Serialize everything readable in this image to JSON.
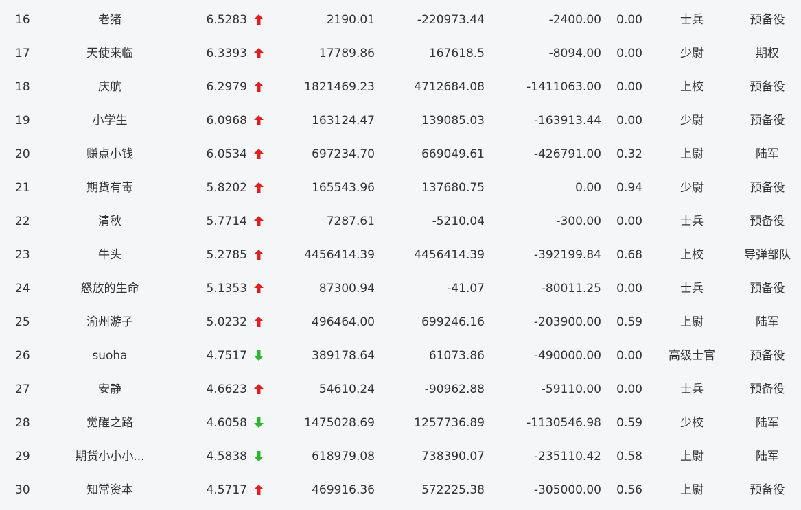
{
  "colors": {
    "up": "#e02020",
    "down": "#2bb52b",
    "text": "#333333",
    "background": "#f5f6f8"
  },
  "rows": [
    {
      "rank": "16",
      "name": "老猪",
      "score": "6.5283",
      "trend": "up",
      "v1": "2190.01",
      "v2": "-220973.44",
      "v3": "-2400.00",
      "ratio": "0.00",
      "level": "士兵",
      "category": "预备役"
    },
    {
      "rank": "17",
      "name": "天使来临",
      "score": "6.3393",
      "trend": "up",
      "v1": "17789.86",
      "v2": "167618.5",
      "v3": "-8094.00",
      "ratio": "0.00",
      "level": "少尉",
      "category": "期权"
    },
    {
      "rank": "18",
      "name": "庆航",
      "score": "6.2979",
      "trend": "up",
      "v1": "1821469.23",
      "v2": "4712684.08",
      "v3": "-1411063.00",
      "ratio": "0.00",
      "level": "上校",
      "category": "预备役"
    },
    {
      "rank": "19",
      "name": "小学生",
      "score": "6.0968",
      "trend": "up",
      "v1": "163124.47",
      "v2": "139085.03",
      "v3": "-163913.44",
      "ratio": "0.00",
      "level": "少尉",
      "category": "预备役"
    },
    {
      "rank": "20",
      "name": "赚点小钱",
      "score": "6.0534",
      "trend": "up",
      "v1": "697234.70",
      "v2": "669049.61",
      "v3": "-426791.00",
      "ratio": "0.32",
      "level": "上尉",
      "category": "陆军"
    },
    {
      "rank": "21",
      "name": "期货有毒",
      "score": "5.8202",
      "trend": "up",
      "v1": "165543.96",
      "v2": "137680.75",
      "v3": "0.00",
      "ratio": "0.94",
      "level": "少尉",
      "category": "预备役"
    },
    {
      "rank": "22",
      "name": "清秋",
      "score": "5.7714",
      "trend": "up",
      "v1": "7287.61",
      "v2": "-5210.04",
      "v3": "-300.00",
      "ratio": "0.00",
      "level": "士兵",
      "category": "预备役"
    },
    {
      "rank": "23",
      "name": "牛头",
      "score": "5.2785",
      "trend": "up",
      "v1": "4456414.39",
      "v2": "4456414.39",
      "v3": "-392199.84",
      "ratio": "0.68",
      "level": "上校",
      "category": "导弹部队"
    },
    {
      "rank": "24",
      "name": "怒放的生命",
      "score": "5.1353",
      "trend": "up",
      "v1": "87300.94",
      "v2": "-41.07",
      "v3": "-80011.25",
      "ratio": "0.00",
      "level": "士兵",
      "category": "预备役"
    },
    {
      "rank": "25",
      "name": "渝州游子",
      "score": "5.0232",
      "trend": "up",
      "v1": "496464.00",
      "v2": "699246.16",
      "v3": "-203900.00",
      "ratio": "0.59",
      "level": "上尉",
      "category": "陆军"
    },
    {
      "rank": "26",
      "name": "suoha",
      "score": "4.7517",
      "trend": "down",
      "v1": "389178.64",
      "v2": "61073.86",
      "v3": "-490000.00",
      "ratio": "0.00",
      "level": "高级士官",
      "category": "预备役"
    },
    {
      "rank": "27",
      "name": "安静",
      "score": "4.6623",
      "trend": "up",
      "v1": "54610.24",
      "v2": "-90962.88",
      "v3": "-59110.00",
      "ratio": "0.00",
      "level": "士兵",
      "category": "预备役"
    },
    {
      "rank": "28",
      "name": "觉醒之路",
      "score": "4.6058",
      "trend": "down",
      "v1": "1475028.69",
      "v2": "1257736.89",
      "v3": "-1130546.98",
      "ratio": "0.59",
      "level": "少校",
      "category": "陆军"
    },
    {
      "rank": "29",
      "name": "期货小小小...",
      "score": "4.5838",
      "trend": "down",
      "v1": "618979.08",
      "v2": "738390.07",
      "v3": "-235110.42",
      "ratio": "0.58",
      "level": "上尉",
      "category": "陆军"
    },
    {
      "rank": "30",
      "name": "知常资本",
      "score": "4.5717",
      "trend": "up",
      "v1": "469916.36",
      "v2": "572225.38",
      "v3": "-305000.00",
      "ratio": "0.56",
      "level": "上尉",
      "category": "预备役"
    }
  ]
}
